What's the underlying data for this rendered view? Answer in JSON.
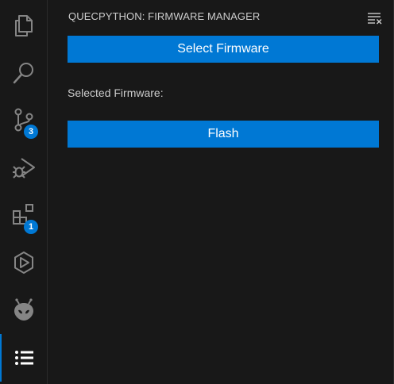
{
  "activity_bar": {
    "badges": {
      "source_control": "3",
      "extensions": "1"
    }
  },
  "panel": {
    "title": "QUECPYTHON: FIRMWARE MANAGER",
    "select_button": "Select Firmware",
    "selected_label": "Selected Firmware:",
    "flash_button": "Flash"
  },
  "colors": {
    "accent": "#0078d4",
    "background": "#181818",
    "icon": "#858585",
    "text": "#cccccc"
  }
}
